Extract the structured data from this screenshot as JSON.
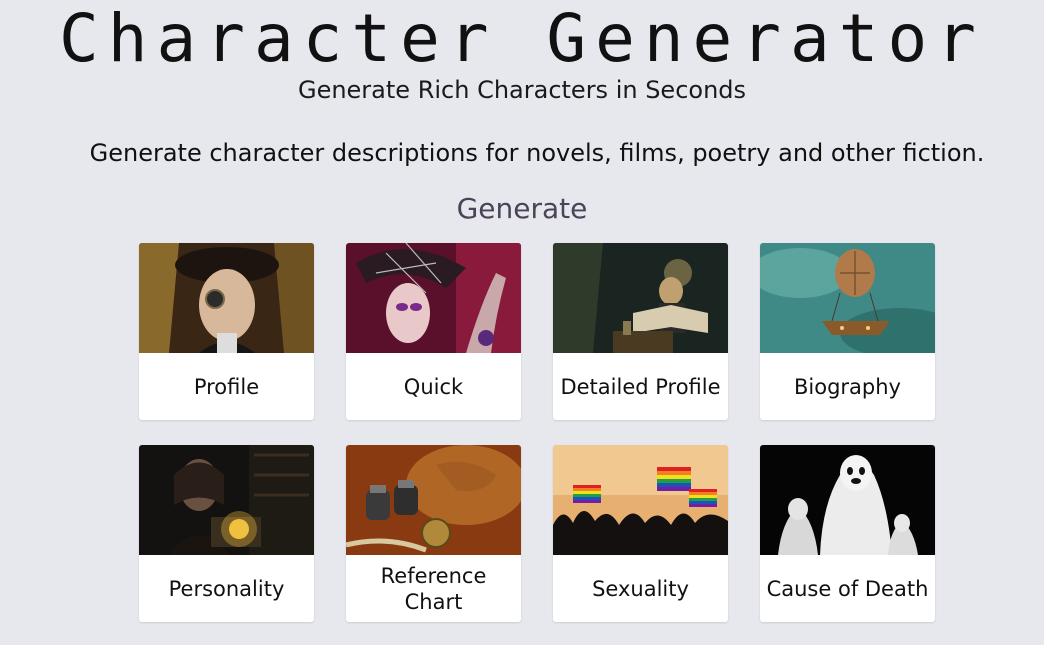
{
  "header": {
    "title": "Character Generator",
    "tagline": "Generate Rich Characters in Seconds",
    "description": "Generate character descriptions for novels, films, poetry and other fiction."
  },
  "generate_section": {
    "heading": "Generate",
    "cards": [
      {
        "label": "Profile",
        "image": "steampunk-woman-goggles-portrait"
      },
      {
        "label": "Quick",
        "image": "woman-feathered-hat-portrait"
      },
      {
        "label": "Detailed Profile",
        "image": "man-reading-book-desk"
      },
      {
        "label": "Biography",
        "image": "hot-air-balloon-airship-sky"
      },
      {
        "label": "Personality",
        "image": "woman-machine-dark-library"
      },
      {
        "label": "Reference Chart",
        "image": "binoculars-compass-map"
      },
      {
        "label": "Sexuality",
        "image": "crowd-rainbow-flags"
      },
      {
        "label": "Cause of Death",
        "image": "ghost-figures-white-sheets"
      }
    ]
  },
  "colors": {
    "background": "#e6e8ee",
    "card_background": "#ffffff",
    "section_heading": "#4a4458"
  }
}
